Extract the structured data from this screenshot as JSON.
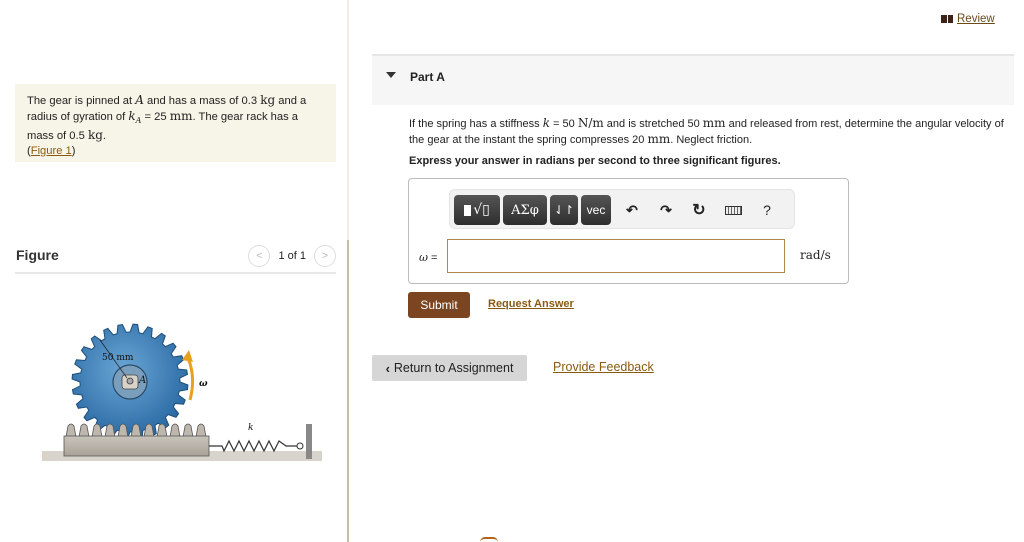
{
  "header": {
    "review_label": "Review",
    "review_icon": "book-icon"
  },
  "problem": {
    "text_1": "The gear is pinned at ",
    "var_A": "A",
    "text_2": " and has a mass of 0.3 ",
    "unit_kg": "kg",
    "text_3": " and a radius of gyration of ",
    "var_kA": "k",
    "var_kA_sub": "A",
    "text_4": " = 25 ",
    "unit_mm": "mm",
    "text_5": ". The gear rack has a mass of 0.5 ",
    "unit_kg2": "kg",
    "text_6": ".",
    "figure_link_open": "(",
    "figure_link": "Figure 1",
    "figure_link_close": ")"
  },
  "figure": {
    "title": "Figure",
    "pager": "1 of 1",
    "prev_icon": "chevron-left-icon",
    "next_icon": "chevron-right-icon",
    "labels": {
      "radius": "50 mm",
      "pin": "A",
      "omega": "ω",
      "spring": "k"
    }
  },
  "part": {
    "title": "Part A",
    "question_1": "If the spring has a stiffness ",
    "k_var": "k",
    "question_2": " = 50 ",
    "unit_Nm": "N/m",
    "question_3": " and is stretched 50 ",
    "unit_mm1": "mm",
    "question_4": " and released from rest, determine the angular velocity of the gear at the instant the spring compresses 20 ",
    "unit_mm2": "mm",
    "question_5": ". Neglect friction.",
    "instruction": "Express your answer in radians per second to three significant figures."
  },
  "toolbar": {
    "templates_label": "▮√▯",
    "greek_label": "ΑΣφ",
    "arrows_label": "⇃↾",
    "vec_label": "vec",
    "undo_icon": "↶",
    "redo_icon": "↷",
    "reset_icon": "↻",
    "help_label": "?"
  },
  "answer": {
    "variable": "ω",
    "equals": " =",
    "value": "",
    "placeholder": "",
    "units": "rad/s"
  },
  "actions": {
    "submit_label": "Submit",
    "request_answer_label": "Request Answer",
    "return_label": "Return to Assignment",
    "feedback_label": "Provide Feedback"
  },
  "colors": {
    "accent_brown": "#7a4520",
    "link": "#8a5a12",
    "problem_bg": "#f7f5e8",
    "gear_blue": "#3d7fb8",
    "omega_arrow": "#e8a020"
  }
}
